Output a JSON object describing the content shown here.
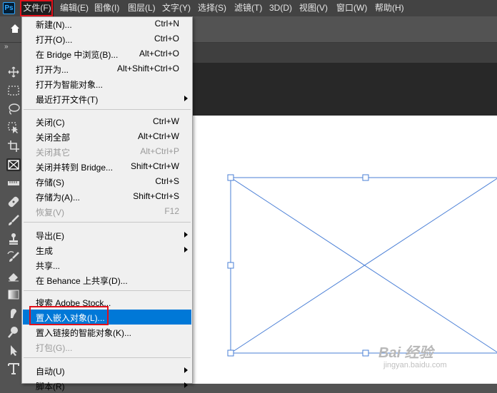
{
  "app": {
    "logo": "Ps"
  },
  "menubar": {
    "items": [
      "文件(F)",
      "编辑(E)",
      "图像(I)",
      "图层(L)",
      "文字(Y)",
      "选择(S)",
      "滤镜(T)",
      "3D(D)",
      "视图(V)",
      "窗口(W)",
      "帮助(H)"
    ],
    "active_index": 0
  },
  "toolbar": {
    "collapse_label": "»"
  },
  "file_menu": {
    "items": [
      {
        "label": "新建(N)...",
        "shortcut": "Ctrl+N"
      },
      {
        "label": "打开(O)...",
        "shortcut": "Ctrl+O"
      },
      {
        "label": "在 Bridge 中浏览(B)...",
        "shortcut": "Alt+Ctrl+O"
      },
      {
        "label": "打开为...",
        "shortcut": "Alt+Shift+Ctrl+O"
      },
      {
        "label": "打开为智能对象...",
        "shortcut": ""
      },
      {
        "label": "最近打开文件(T)",
        "shortcut": ""
      },
      {
        "label": "关闭(C)",
        "shortcut": "Ctrl+W"
      },
      {
        "label": "关闭全部",
        "shortcut": "Alt+Ctrl+W"
      },
      {
        "label": "关闭其它",
        "shortcut": "Alt+Ctrl+P"
      },
      {
        "label": "关闭并转到 Bridge...",
        "shortcut": "Shift+Ctrl+W"
      },
      {
        "label": "存储(S)",
        "shortcut": "Ctrl+S"
      },
      {
        "label": "存储为(A)...",
        "shortcut": "Shift+Ctrl+S"
      },
      {
        "label": "恢复(V)",
        "shortcut": "F12"
      },
      {
        "label": "导出(E)",
        "shortcut": ""
      },
      {
        "label": "生成",
        "shortcut": ""
      },
      {
        "label": "共享...",
        "shortcut": ""
      },
      {
        "label": "在 Behance 上共享(D)...",
        "shortcut": ""
      },
      {
        "label": "搜索 Adobe Stock...",
        "shortcut": ""
      },
      {
        "label": "置入嵌入对象(L)...",
        "shortcut": ""
      },
      {
        "label": "置入链接的智能对象(K)...",
        "shortcut": ""
      },
      {
        "label": "打包(G)...",
        "shortcut": ""
      },
      {
        "label": "自动(U)",
        "shortcut": ""
      },
      {
        "label": "脚本(R)",
        "shortcut": ""
      }
    ]
  },
  "watermark": {
    "text": "Bai 经验",
    "sub": "jingyan.baidu.com"
  },
  "colors": {
    "highlight": "#0078d7",
    "annotation_red": "#e1101a",
    "frame_blue": "#4a7fd6"
  }
}
